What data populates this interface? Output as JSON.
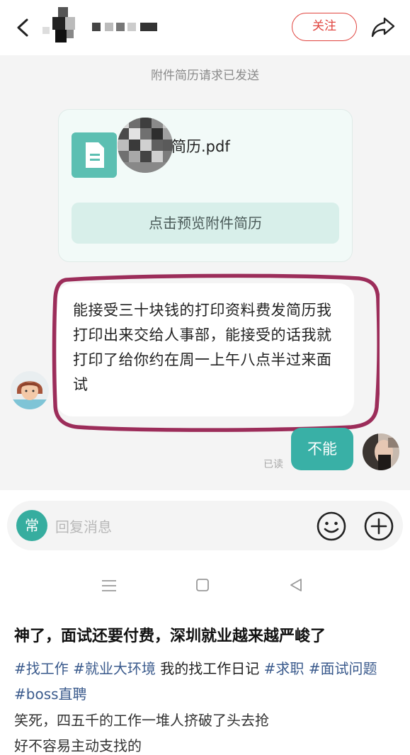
{
  "header": {
    "back_icon": "chevron-left-icon",
    "follow_label": "关注",
    "share_icon": "share-arrow-icon"
  },
  "chat": {
    "system_note": "附件简历请求已发送",
    "file_card": {
      "file_name": "简历.pdf",
      "file_icon": "document-icon",
      "preview_label": "点击预览附件简历"
    },
    "message_text": "能接受三十块钱的打印资料费发简历我打印出来交给人事部，能接受的话我就打印了给你约在周一上午八点半过来面试",
    "reply_text": "不能",
    "read_status": "已读"
  },
  "input_bar": {
    "quick_phrase_label": "常",
    "placeholder": "回复消息",
    "emoji_icon": "smiley-icon",
    "plus_icon": "plus-circle-icon"
  },
  "system_nav": {
    "menu_icon": "menu-icon",
    "home_icon": "home-square-icon",
    "back_icon": "back-triangle-icon"
  },
  "post": {
    "title": "神了，面试还要付费，深圳就业越来越严峻了",
    "tags": [
      "#找工作",
      "#就业大环境",
      "我的找工作日记",
      "#求职",
      "#面试问题",
      "#boss直聘"
    ],
    "comment": "笑死，四五千的工作一堆人挤破了头去抢",
    "comment_partial": "好不容易主动支找的"
  },
  "colors": {
    "accent_teal": "#39b0a6",
    "follow_red": "#e0443f",
    "outline_maroon": "#9c2d5a",
    "tag_blue": "#3a5a8c"
  }
}
